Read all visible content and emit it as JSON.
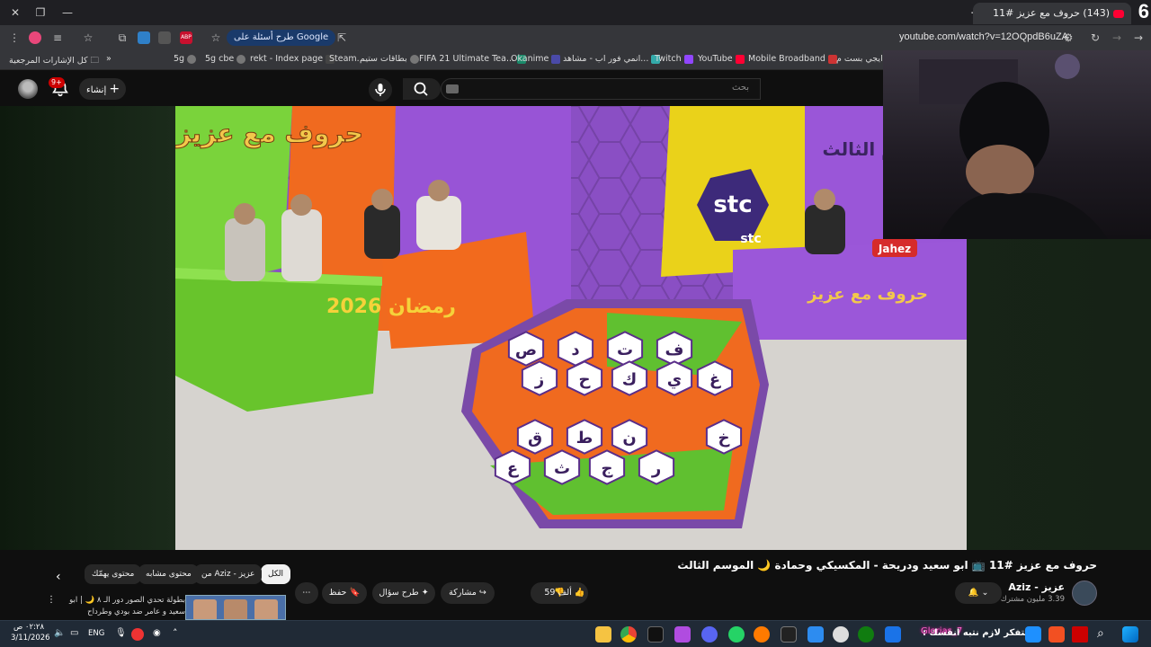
{
  "browser": {
    "tab_title": "(143) حروف مع عزيز #11",
    "url": "youtube.com/watch?v=12OQpdB6uZA",
    "google_chip": "طرح أسئلة على Google",
    "corner_number": "6"
  },
  "bookmarks": {
    "all_bookmarks": "كل الإشارات المرجعية",
    "items": [
      "5g",
      "5g cbe",
      "rekt - Index page",
      "Steam...",
      "بطاقات ستيم",
      "FIFA 21 Ultimate Tea...",
      "Okanime",
      "انمي فور اب - مشاهد...",
      "Twitch",
      "YouTube",
      "Mobile Broadband",
      "ايجي بست م..."
    ]
  },
  "youtube": {
    "search_placeholder": "بحث",
    "create_label": "إنشاء",
    "notif_count": "9+"
  },
  "video": {
    "title": "حروف مع عزيز #11 📺 ابو سعيد ودريحة - المكسيكي وحمادة 🌙 الموسم الثالث",
    "channel_name": "عزيز - Aziz",
    "subscribers": "3.39 مليون مشترك",
    "like_count": "59 ألف",
    "share_label": "مشاركة",
    "ask_label": "طرح سؤال",
    "save_label": "حفظ",
    "overlay_logo": "حروف مع عزيز",
    "overlay_season": "سم الثالث",
    "sponsor": "stc",
    "sponsor2": "Jahez",
    "ramadan": "رمضان 2026",
    "board_letters": [
      "ص",
      "د",
      "ت",
      "ف",
      "ز",
      "ح",
      "ك",
      "ي",
      "غ",
      "ق",
      "ط",
      "ن",
      "خ",
      "ع",
      "ث",
      "ج",
      "ر"
    ]
  },
  "chips": {
    "all": "الكل",
    "from_aziz": "من Aziz - عزيز",
    "similar": "محتوى مشابه",
    "interests": "محتوى يهمّك"
  },
  "recommendation": {
    "text": "بطولة تحدي الصور دور الـ ٨ 🌙 | ابو سعيد و عامر ضد بودي وطرداح"
  },
  "taskbar": {
    "time": "٠٢:٢٨ ص",
    "date": "3/11/2026",
    "lang": "ENG",
    "ticker": "متفكر لازم نتبه انفسك :",
    "ticker_name": "Glorias_7"
  }
}
